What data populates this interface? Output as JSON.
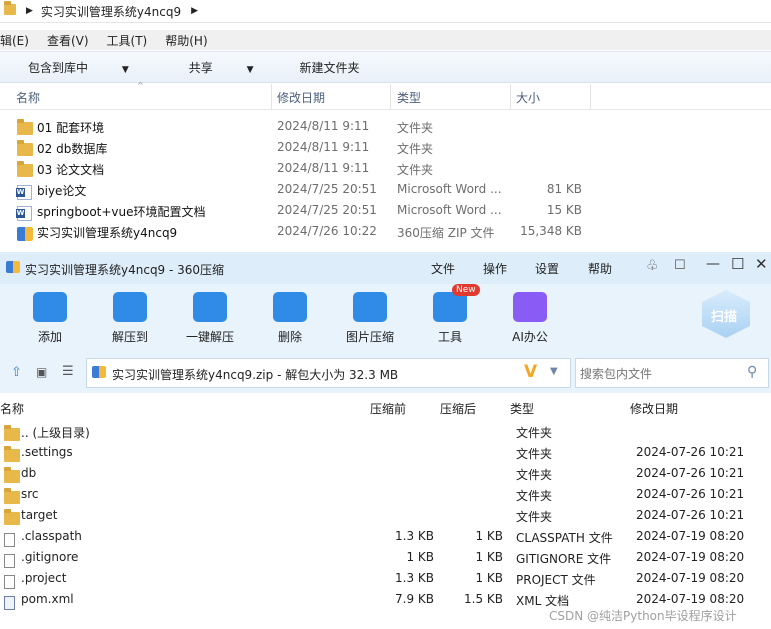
{
  "explorer": {
    "breadcrumb": "实习实训管理系统y4ncq9",
    "menu": [
      "辑(E)",
      "查看(V)",
      "工具(T)",
      "帮助(H)"
    ],
    "commands": [
      "包含到库中",
      "共享",
      "新建文件夹"
    ],
    "columns": {
      "name": "名称",
      "date": "修改日期",
      "type": "类型",
      "size": "大小"
    },
    "files": [
      {
        "icon": "folder-icon",
        "name": "01 配套环境",
        "date": "2024/8/11 9:11",
        "type": "文件夹",
        "size": ""
      },
      {
        "icon": "folder-icon",
        "name": "02 db数据库",
        "date": "2024/8/11 9:11",
        "type": "文件夹",
        "size": ""
      },
      {
        "icon": "folder-icon",
        "name": "03 论文文档",
        "date": "2024/8/11 9:11",
        "type": "文件夹",
        "size": ""
      },
      {
        "icon": "word-doc-icon",
        "name": "biye论文",
        "date": "2024/7/25 20:51",
        "type": "Microsoft Word ...",
        "size": "81 KB"
      },
      {
        "icon": "word-doc-icon",
        "name": "springboot+vue环境配置文档",
        "date": "2024/7/25 20:51",
        "type": "Microsoft Word ...",
        "size": "15 KB"
      },
      {
        "icon": "zip-archive-icon",
        "name": "实习实训管理系统y4ncq9",
        "date": "2024/7/26 10:22",
        "type": "360压缩 ZIP 文件",
        "size": "15,348 KB"
      }
    ]
  },
  "zip": {
    "title": "实习实训管理系统y4ncq9 - 360压缩",
    "menu": [
      "文件",
      "操作",
      "设置",
      "帮助"
    ],
    "tools": [
      {
        "label": "添加",
        "icon": "add-icon",
        "color": "#2f8be6"
      },
      {
        "label": "解压到",
        "icon": "extract-to-icon",
        "color": "#2f8be6"
      },
      {
        "label": "一键解压",
        "icon": "one-click-extract-icon",
        "color": "#2f8be6"
      },
      {
        "label": "删除",
        "icon": "recycle-bin-icon",
        "color": "#2f8be6"
      },
      {
        "label": "图片压缩",
        "icon": "image-compress-icon",
        "color": "#2f8be6"
      },
      {
        "label": "工具",
        "icon": "tools-icon",
        "color": "#2f8be6"
      },
      {
        "label": "AI办公",
        "icon": "ai-office-icon",
        "color": "#8a5cf6"
      }
    ],
    "new_badge": "New",
    "scan_label": "扫描",
    "path": "实习实训管理系统y4ncq9.zip - 解包大小为 32.3 MB",
    "search_placeholder": "搜索包内文件",
    "columns": {
      "name": "名称",
      "size": "压缩前",
      "compressed": "压缩后",
      "type": "类型",
      "date": "修改日期"
    },
    "rows": [
      {
        "icon": "folder-icon",
        "name": ".. (上级目录)",
        "size": "",
        "compressed": "",
        "type": "文件夹",
        "date": ""
      },
      {
        "icon": "folder-icon",
        "name": ".settings",
        "size": "",
        "compressed": "",
        "type": "文件夹",
        "date": "2024-07-26 10:21"
      },
      {
        "icon": "folder-icon",
        "name": "db",
        "size": "",
        "compressed": "",
        "type": "文件夹",
        "date": "2024-07-26 10:21"
      },
      {
        "icon": "folder-icon",
        "name": "src",
        "size": "",
        "compressed": "",
        "type": "文件夹",
        "date": "2024-07-26 10:21"
      },
      {
        "icon": "folder-icon",
        "name": "target",
        "size": "",
        "compressed": "",
        "type": "文件夹",
        "date": "2024-07-26 10:21"
      },
      {
        "icon": "file-icon",
        "name": ".classpath",
        "size": "1.3 KB",
        "compressed": "1 KB",
        "type": "CLASSPATH 文件",
        "date": "2024-07-19 08:20"
      },
      {
        "icon": "file-icon",
        "name": ".gitignore",
        "size": "1 KB",
        "compressed": "1 KB",
        "type": "GITIGNORE 文件",
        "date": "2024-07-19 08:20"
      },
      {
        "icon": "file-icon",
        "name": ".project",
        "size": "1.3 KB",
        "compressed": "1 KB",
        "type": "PROJECT 文件",
        "date": "2024-07-19 08:20"
      },
      {
        "icon": "xml-file-icon",
        "name": "pom.xml",
        "size": "7.9 KB",
        "compressed": "1.5 KB",
        "type": "XML 文档",
        "date": "2024-07-19 08:20"
      }
    ]
  },
  "watermark": "CSDN @纯洁Python毕设程序设计"
}
